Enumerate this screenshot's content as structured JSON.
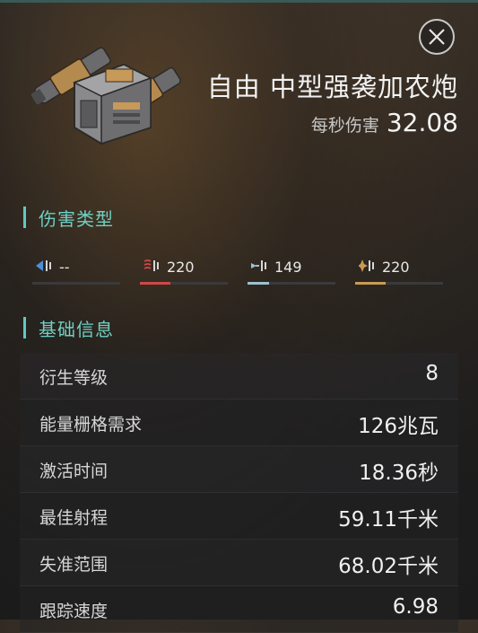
{
  "header": {
    "title": "自由 中型强袭加农炮",
    "dps_label": "每秒伤害",
    "dps_value": "32.08"
  },
  "damage_types": {
    "section_label": "伤害类型",
    "items": [
      {
        "icon": "em-damage-icon",
        "value": "--",
        "color": "#4f8fd6",
        "fill": 0
      },
      {
        "icon": "thermal-damage-icon",
        "value": "220",
        "color": "#d0474a",
        "fill": 0.35
      },
      {
        "icon": "kinetic-damage-icon",
        "value": "149",
        "color": "#9cc0d0",
        "fill": 0.24
      },
      {
        "icon": "explosive-damage-icon",
        "value": "220",
        "color": "#c89b55",
        "fill": 0.35
      }
    ]
  },
  "basic_info": {
    "section_label": "基础信息",
    "rows": [
      {
        "label": "衍生等级",
        "value": "8"
      },
      {
        "label": "能量栅格需求",
        "value": "126兆瓦"
      },
      {
        "label": "激活时间",
        "value": "18.36秒"
      },
      {
        "label": "最佳射程",
        "value": "59.11千米"
      },
      {
        "label": "失准范围",
        "value": "68.02千米"
      },
      {
        "label": "跟踪速度",
        "value": "6.98"
      }
    ]
  },
  "icons": {
    "close": "close-icon",
    "weapon": "assault-cannon-image"
  },
  "colors": {
    "accent": "#6fd0c4"
  }
}
